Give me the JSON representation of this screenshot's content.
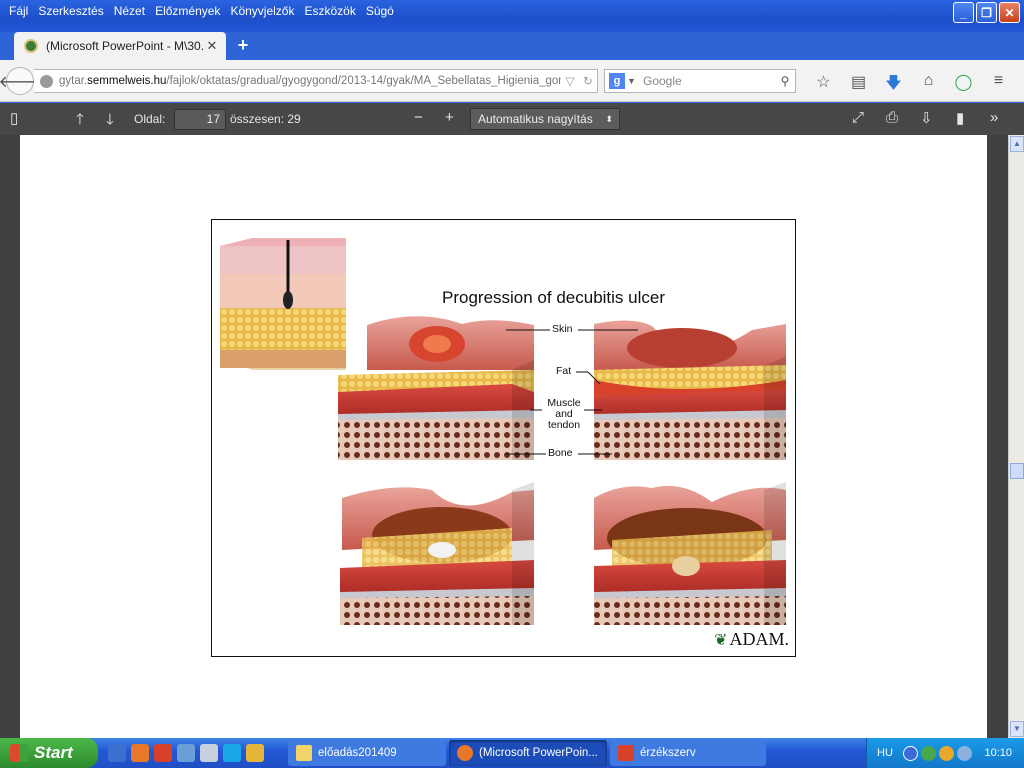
{
  "menu": [
    {
      "label": "Fájl"
    },
    {
      "label": "Szerkesztés"
    },
    {
      "label": "Nézet"
    },
    {
      "label": "Előzmények"
    },
    {
      "label": "Könyvjelzők"
    },
    {
      "label": "Eszközök"
    },
    {
      "label": "Súgó"
    }
  ],
  "tab": {
    "title": "(Microsoft PowerPoint - M\\30...",
    "close": "✕",
    "new_tab": "+"
  },
  "url": {
    "prefix": "gytar.",
    "host": "semmelweis.hu",
    "path": "/fajlok/oktatas/gradual/gyogygond/2013-14/gyak/MA_Sebellatas_Higienia_gond_g"
  },
  "search": {
    "engine": "g",
    "placeholder": "Google"
  },
  "pdf_toolbar": {
    "page_label": "Oldal:",
    "page_value": "17",
    "total_label": "összesen: 29",
    "zoom": "Automatikus nagyítás"
  },
  "figure": {
    "title": "Progression of decubitis ulcer",
    "labels": {
      "skin": "Skin",
      "fat": "Fat",
      "muscle_1": "Muscle",
      "muscle_2": "and",
      "muscle_3": "tendon",
      "bone": "Bone"
    },
    "logo": "ADAM."
  },
  "taskbar": {
    "start": "Start",
    "buttons": [
      {
        "label": "előadás201409"
      },
      {
        "label": "(Microsoft PowerPoin..."
      },
      {
        "label": "érzékszerv"
      }
    ],
    "lang": "HU",
    "clock": "10:10"
  },
  "colors": {
    "xp_blue": "#2358d6",
    "pdf_toolbar": "#474747",
    "viewer_bg": "#404040",
    "start_green": "#3ca23c"
  }
}
